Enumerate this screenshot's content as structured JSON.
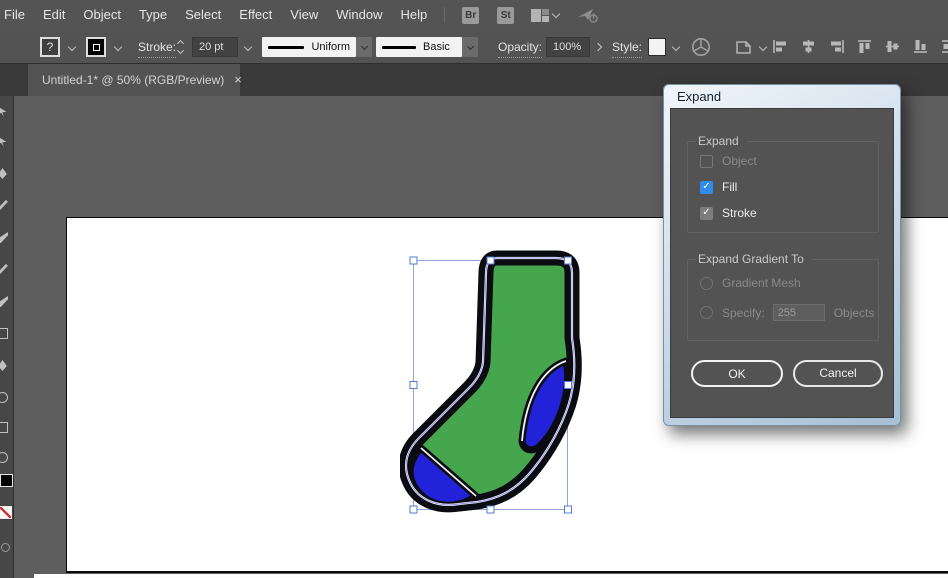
{
  "menu_bar": {
    "items": [
      "File",
      "Edit",
      "Object",
      "Type",
      "Select",
      "Effect",
      "View",
      "Window",
      "Help"
    ],
    "bridge_icon": "Br",
    "stock_icon": "St"
  },
  "control_bar": {
    "fill_swatch_label": "?",
    "stroke_label": "Stroke:",
    "stroke_weight": "20 pt",
    "variable_width_profile": "Uniform",
    "brush_definition": "Basic",
    "opacity_label": "Opacity:",
    "opacity_value": "100%",
    "style_label": "Style:"
  },
  "tab_bar": {
    "document_title": "Untitled-1* @ 50% (RGB/Preview)",
    "close_glyph": "×"
  },
  "dialog": {
    "title": "Expand",
    "check_glyph": "✓",
    "expand_group": {
      "title": "Expand",
      "options": [
        {
          "label": "Object",
          "state": "unchecked-disabled"
        },
        {
          "label": "Fill",
          "state": "checked"
        },
        {
          "label": "Stroke",
          "state": "checked"
        }
      ]
    },
    "gradient_group": {
      "title": "Expand Gradient To",
      "radio_1": "Gradient Mesh",
      "radio_2": "Specify:",
      "specify_value": "255",
      "objects_label": "Objects"
    },
    "buttons": {
      "ok": "OK",
      "cancel": "Cancel"
    }
  },
  "canvas": {
    "artwork": "sock illustration, selected",
    "colors": {
      "body": "#46a64d",
      "accent": "#2222d8",
      "outline": "#0b0b12",
      "selection": "#8ea7d0"
    }
  }
}
